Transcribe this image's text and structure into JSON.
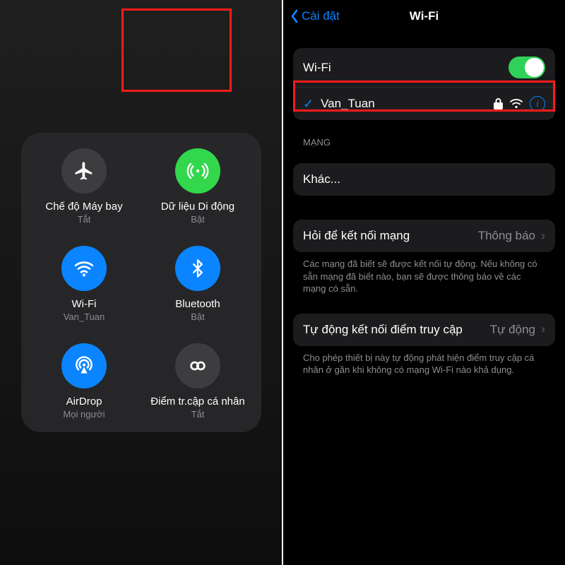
{
  "control_center": {
    "tiles": [
      {
        "id": "airplane",
        "title": "Chế độ Máy bay",
        "sub": "Tắt",
        "color": "gray"
      },
      {
        "id": "cellular",
        "title": "Dữ liệu Di động",
        "sub": "Bật",
        "color": "green"
      },
      {
        "id": "wifi",
        "title": "Wi-Fi",
        "sub": "Van_Tuan",
        "color": "blue"
      },
      {
        "id": "bluetooth",
        "title": "Bluetooth",
        "sub": "Bật",
        "color": "blue"
      },
      {
        "id": "airdrop",
        "title": "AirDrop",
        "sub": "Mọi người",
        "color": "blue"
      },
      {
        "id": "hotspot",
        "title": "Điểm tr.cập cá nhân",
        "sub": "Tắt",
        "color": "gray"
      }
    ]
  },
  "settings": {
    "back": "Cài đặt",
    "title": "Wi-Fi",
    "wifi_row_label": "Wi-Fi",
    "connected_network": "Van_Tuan",
    "networks_header": "MẠNG",
    "other_label": "Khác...",
    "ask_row": {
      "label": "Hỏi để kết nối mạng",
      "value": "Thông báo"
    },
    "ask_footer": "Các mạng đã biết sẽ được kết nối tự động. Nếu không có sẵn mạng đã biết nào, bạn sẽ được thông báo về các mạng có sẵn.",
    "auto_row": {
      "label": "Tự động kết nối điểm truy cập",
      "value": "Tự động"
    },
    "auto_footer": "Cho phép thiết bị này tự động phát hiện điểm truy cập cá nhân ở gần khi không có mạng Wi-Fi nào khả dụng."
  },
  "colors": {
    "accent_blue": "#0a84ff",
    "accent_green": "#32d74b",
    "highlight_red": "#ff1a1a"
  }
}
